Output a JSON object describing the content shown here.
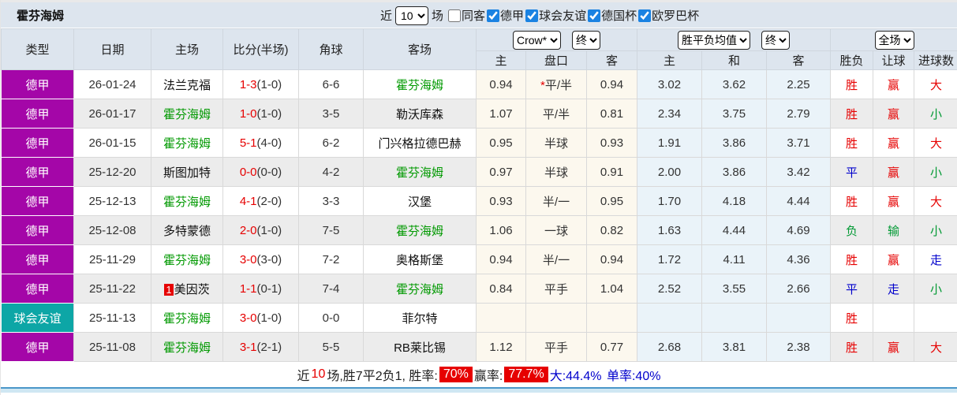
{
  "title": "霍芬海姆",
  "toolbar": {
    "near_label": "近",
    "near_value": "10",
    "field_label": "场",
    "same_away": {
      "label": "同客",
      "checked": false
    },
    "filters": [
      {
        "label": "德甲",
        "checked": true
      },
      {
        "label": "球会友谊",
        "checked": true
      },
      {
        "label": "德国杯",
        "checked": true
      },
      {
        "label": "欧罗巴杯",
        "checked": true
      }
    ]
  },
  "table": {
    "headers": [
      "类型",
      "日期",
      "主场",
      "比分(半场)",
      "角球",
      "客场"
    ],
    "selects": {
      "company": "Crow*",
      "company_state": "终",
      "avg": "胜平负均值",
      "avg_state": "终",
      "scope": "全场"
    },
    "sub_headers": [
      "主",
      "盘口",
      "客",
      "主",
      "和",
      "客",
      "胜负",
      "让球",
      "进球数"
    ],
    "rows": [
      {
        "league": "德甲",
        "league_type": "bundesliga",
        "date": "26-01-24",
        "home": "法兰克福",
        "home_is_focus": false,
        "home_badge": "",
        "score": "1-3",
        "half": "(1-0)",
        "corners": "6-6",
        "away": "霍芬海姆",
        "away_is_focus": true,
        "handicap_star": true,
        "odds": [
          "0.94",
          "平/半",
          "0.94"
        ],
        "avg": [
          "3.02",
          "3.62",
          "2.25"
        ],
        "results": [
          {
            "text": "胜",
            "color": "red"
          },
          {
            "text": "赢",
            "color": "red"
          },
          {
            "text": "大",
            "color": "red"
          }
        ]
      },
      {
        "league": "德甲",
        "league_type": "bundesliga",
        "date": "26-01-17",
        "home": "霍芬海姆",
        "home_is_focus": true,
        "home_badge": "",
        "score": "1-0",
        "half": "(1-0)",
        "corners": "3-5",
        "away": "勒沃库森",
        "away_is_focus": false,
        "handicap_star": false,
        "odds": [
          "1.07",
          "平/半",
          "0.81"
        ],
        "avg": [
          "2.34",
          "3.75",
          "2.79"
        ],
        "results": [
          {
            "text": "胜",
            "color": "red"
          },
          {
            "text": "赢",
            "color": "red"
          },
          {
            "text": "小",
            "color": "green"
          }
        ]
      },
      {
        "league": "德甲",
        "league_type": "bundesliga",
        "date": "26-01-15",
        "home": "霍芬海姆",
        "home_is_focus": true,
        "home_badge": "",
        "score": "5-1",
        "half": "(4-0)",
        "corners": "6-2",
        "away": "门兴格拉德巴赫",
        "away_is_focus": false,
        "handicap_star": false,
        "odds": [
          "0.95",
          "半球",
          "0.93"
        ],
        "avg": [
          "1.91",
          "3.86",
          "3.71"
        ],
        "results": [
          {
            "text": "胜",
            "color": "red"
          },
          {
            "text": "赢",
            "color": "red"
          },
          {
            "text": "大",
            "color": "red"
          }
        ]
      },
      {
        "league": "德甲",
        "league_type": "bundesliga",
        "date": "25-12-20",
        "home": "斯图加特",
        "home_is_focus": false,
        "home_badge": "",
        "score": "0-0",
        "half": "(0-0)",
        "corners": "4-2",
        "away": "霍芬海姆",
        "away_is_focus": true,
        "handicap_star": false,
        "odds": [
          "0.97",
          "半球",
          "0.91"
        ],
        "avg": [
          "2.00",
          "3.86",
          "3.42"
        ],
        "results": [
          {
            "text": "平",
            "color": "blue"
          },
          {
            "text": "赢",
            "color": "red"
          },
          {
            "text": "小",
            "color": "green"
          }
        ]
      },
      {
        "league": "德甲",
        "league_type": "bundesliga",
        "date": "25-12-13",
        "home": "霍芬海姆",
        "home_is_focus": true,
        "home_badge": "",
        "score": "4-1",
        "half": "(2-0)",
        "corners": "3-3",
        "away": "汉堡",
        "away_is_focus": false,
        "handicap_star": false,
        "odds": [
          "0.93",
          "半/一",
          "0.95"
        ],
        "avg": [
          "1.70",
          "4.18",
          "4.44"
        ],
        "results": [
          {
            "text": "胜",
            "color": "red"
          },
          {
            "text": "赢",
            "color": "red"
          },
          {
            "text": "大",
            "color": "red"
          }
        ]
      },
      {
        "league": "德甲",
        "league_type": "bundesliga",
        "date": "25-12-08",
        "home": "多特蒙德",
        "home_is_focus": false,
        "home_badge": "",
        "score": "2-0",
        "half": "(1-0)",
        "corners": "7-5",
        "away": "霍芬海姆",
        "away_is_focus": true,
        "handicap_star": false,
        "odds": [
          "1.06",
          "一球",
          "0.82"
        ],
        "avg": [
          "1.63",
          "4.44",
          "4.69"
        ],
        "results": [
          {
            "text": "负",
            "color": "green"
          },
          {
            "text": "输",
            "color": "green"
          },
          {
            "text": "小",
            "color": "green"
          }
        ]
      },
      {
        "league": "德甲",
        "league_type": "bundesliga",
        "date": "25-11-29",
        "home": "霍芬海姆",
        "home_is_focus": true,
        "home_badge": "",
        "score": "3-0",
        "half": "(3-0)",
        "corners": "7-2",
        "away": "奥格斯堡",
        "away_is_focus": false,
        "handicap_star": false,
        "odds": [
          "0.94",
          "半/一",
          "0.94"
        ],
        "avg": [
          "1.72",
          "4.11",
          "4.36"
        ],
        "results": [
          {
            "text": "胜",
            "color": "red"
          },
          {
            "text": "赢",
            "color": "red"
          },
          {
            "text": "走",
            "color": "blue"
          }
        ]
      },
      {
        "league": "德甲",
        "league_type": "bundesliga",
        "date": "25-11-22",
        "home": "美因茨",
        "home_is_focus": false,
        "home_badge": "1",
        "score": "1-1",
        "half": "(0-1)",
        "corners": "7-4",
        "away": "霍芬海姆",
        "away_is_focus": true,
        "handicap_star": false,
        "odds": [
          "0.84",
          "平手",
          "1.04"
        ],
        "avg": [
          "2.52",
          "3.55",
          "2.66"
        ],
        "results": [
          {
            "text": "平",
            "color": "blue"
          },
          {
            "text": "走",
            "color": "blue"
          },
          {
            "text": "小",
            "color": "green"
          }
        ]
      },
      {
        "league": "球会友谊",
        "league_type": "friendly",
        "date": "25-11-13",
        "home": "霍芬海姆",
        "home_is_focus": true,
        "home_badge": "",
        "score": "3-0",
        "half": "(1-0)",
        "corners": "0-0",
        "away": "菲尔特",
        "away_is_focus": false,
        "handicap_star": false,
        "odds": [
          "",
          "",
          ""
        ],
        "avg": [
          "",
          "",
          ""
        ],
        "results": [
          {
            "text": "胜",
            "color": "red"
          },
          {
            "text": "",
            "color": ""
          },
          {
            "text": "",
            "color": ""
          }
        ]
      },
      {
        "league": "德甲",
        "league_type": "bundesliga",
        "date": "25-11-08",
        "home": "霍芬海姆",
        "home_is_focus": true,
        "home_badge": "",
        "score": "3-1",
        "half": "(2-1)",
        "corners": "5-5",
        "away": "RB莱比锡",
        "away_is_focus": false,
        "handicap_star": false,
        "odds": [
          "1.12",
          "平手",
          "0.77"
        ],
        "avg": [
          "2.68",
          "3.81",
          "2.38"
        ],
        "results": [
          {
            "text": "胜",
            "color": "red"
          },
          {
            "text": "赢",
            "color": "red"
          },
          {
            "text": "大",
            "color": "red"
          }
        ]
      }
    ]
  },
  "summary": {
    "near": "近",
    "count": "10",
    "body": "场,胜7平2负1, 胜率:",
    "win_pct": "70%",
    "ying_label": "赢率:",
    "ying_pct": "77.7%",
    "big_text": "大:44.4%",
    "single_text": "单率:40%"
  },
  "colors": {
    "league_bundesliga": "#a406a8",
    "league_friendly": "#0da6a6",
    "focus_team_green": "#009900",
    "score_red": "#e60000",
    "result_blue": "#0000cc",
    "result_green": "#009933",
    "badge_red": "#e60000",
    "header_bg": "#dde5ee",
    "handicap_col_bg": "#fcf8ee",
    "avg_col_bg": "#eaf3f9"
  }
}
